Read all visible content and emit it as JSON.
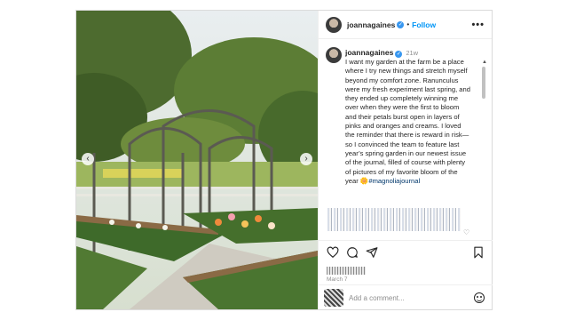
{
  "post": {
    "author": "joannagaines",
    "follow_label": "Follow",
    "separator": "•",
    "more_label": "•••",
    "verified_glyph": "✓",
    "caption": {
      "user": "joannagaines",
      "time": "21w",
      "text": "I want my garden at the farm be a place where I try new things and stretch myself beyond my comfort zone. Ranunculus were my fresh experiment last spring, and they ended up completely winning me over when they were the first to bloom and their petals burst open in layers of pinks and oranges and creams. I loved the reminder that there is reward in risk—so I convinced the team to feature last year’s spring garden in our newest issue of the journal, filled of course with plenty of pictures of my favorite bloom of the year ",
      "emoji": "🌼",
      "hashtag": "#magnoliajournal"
    },
    "date": "March 7",
    "comment_placeholder": "Add a comment...",
    "nav": {
      "prev": "‹",
      "next": "›"
    },
    "scroll": {
      "up": "▲",
      "down": "▼"
    },
    "small_heart": "♡"
  },
  "icons": {
    "like": "heart-icon",
    "comment": "comment-icon",
    "share": "share-icon",
    "save": "bookmark-icon",
    "emoji": "emoji-icon"
  },
  "colors": {
    "link_blue": "#0095f6",
    "verified_blue": "#3897f0",
    "muted": "#8e8e8e"
  }
}
